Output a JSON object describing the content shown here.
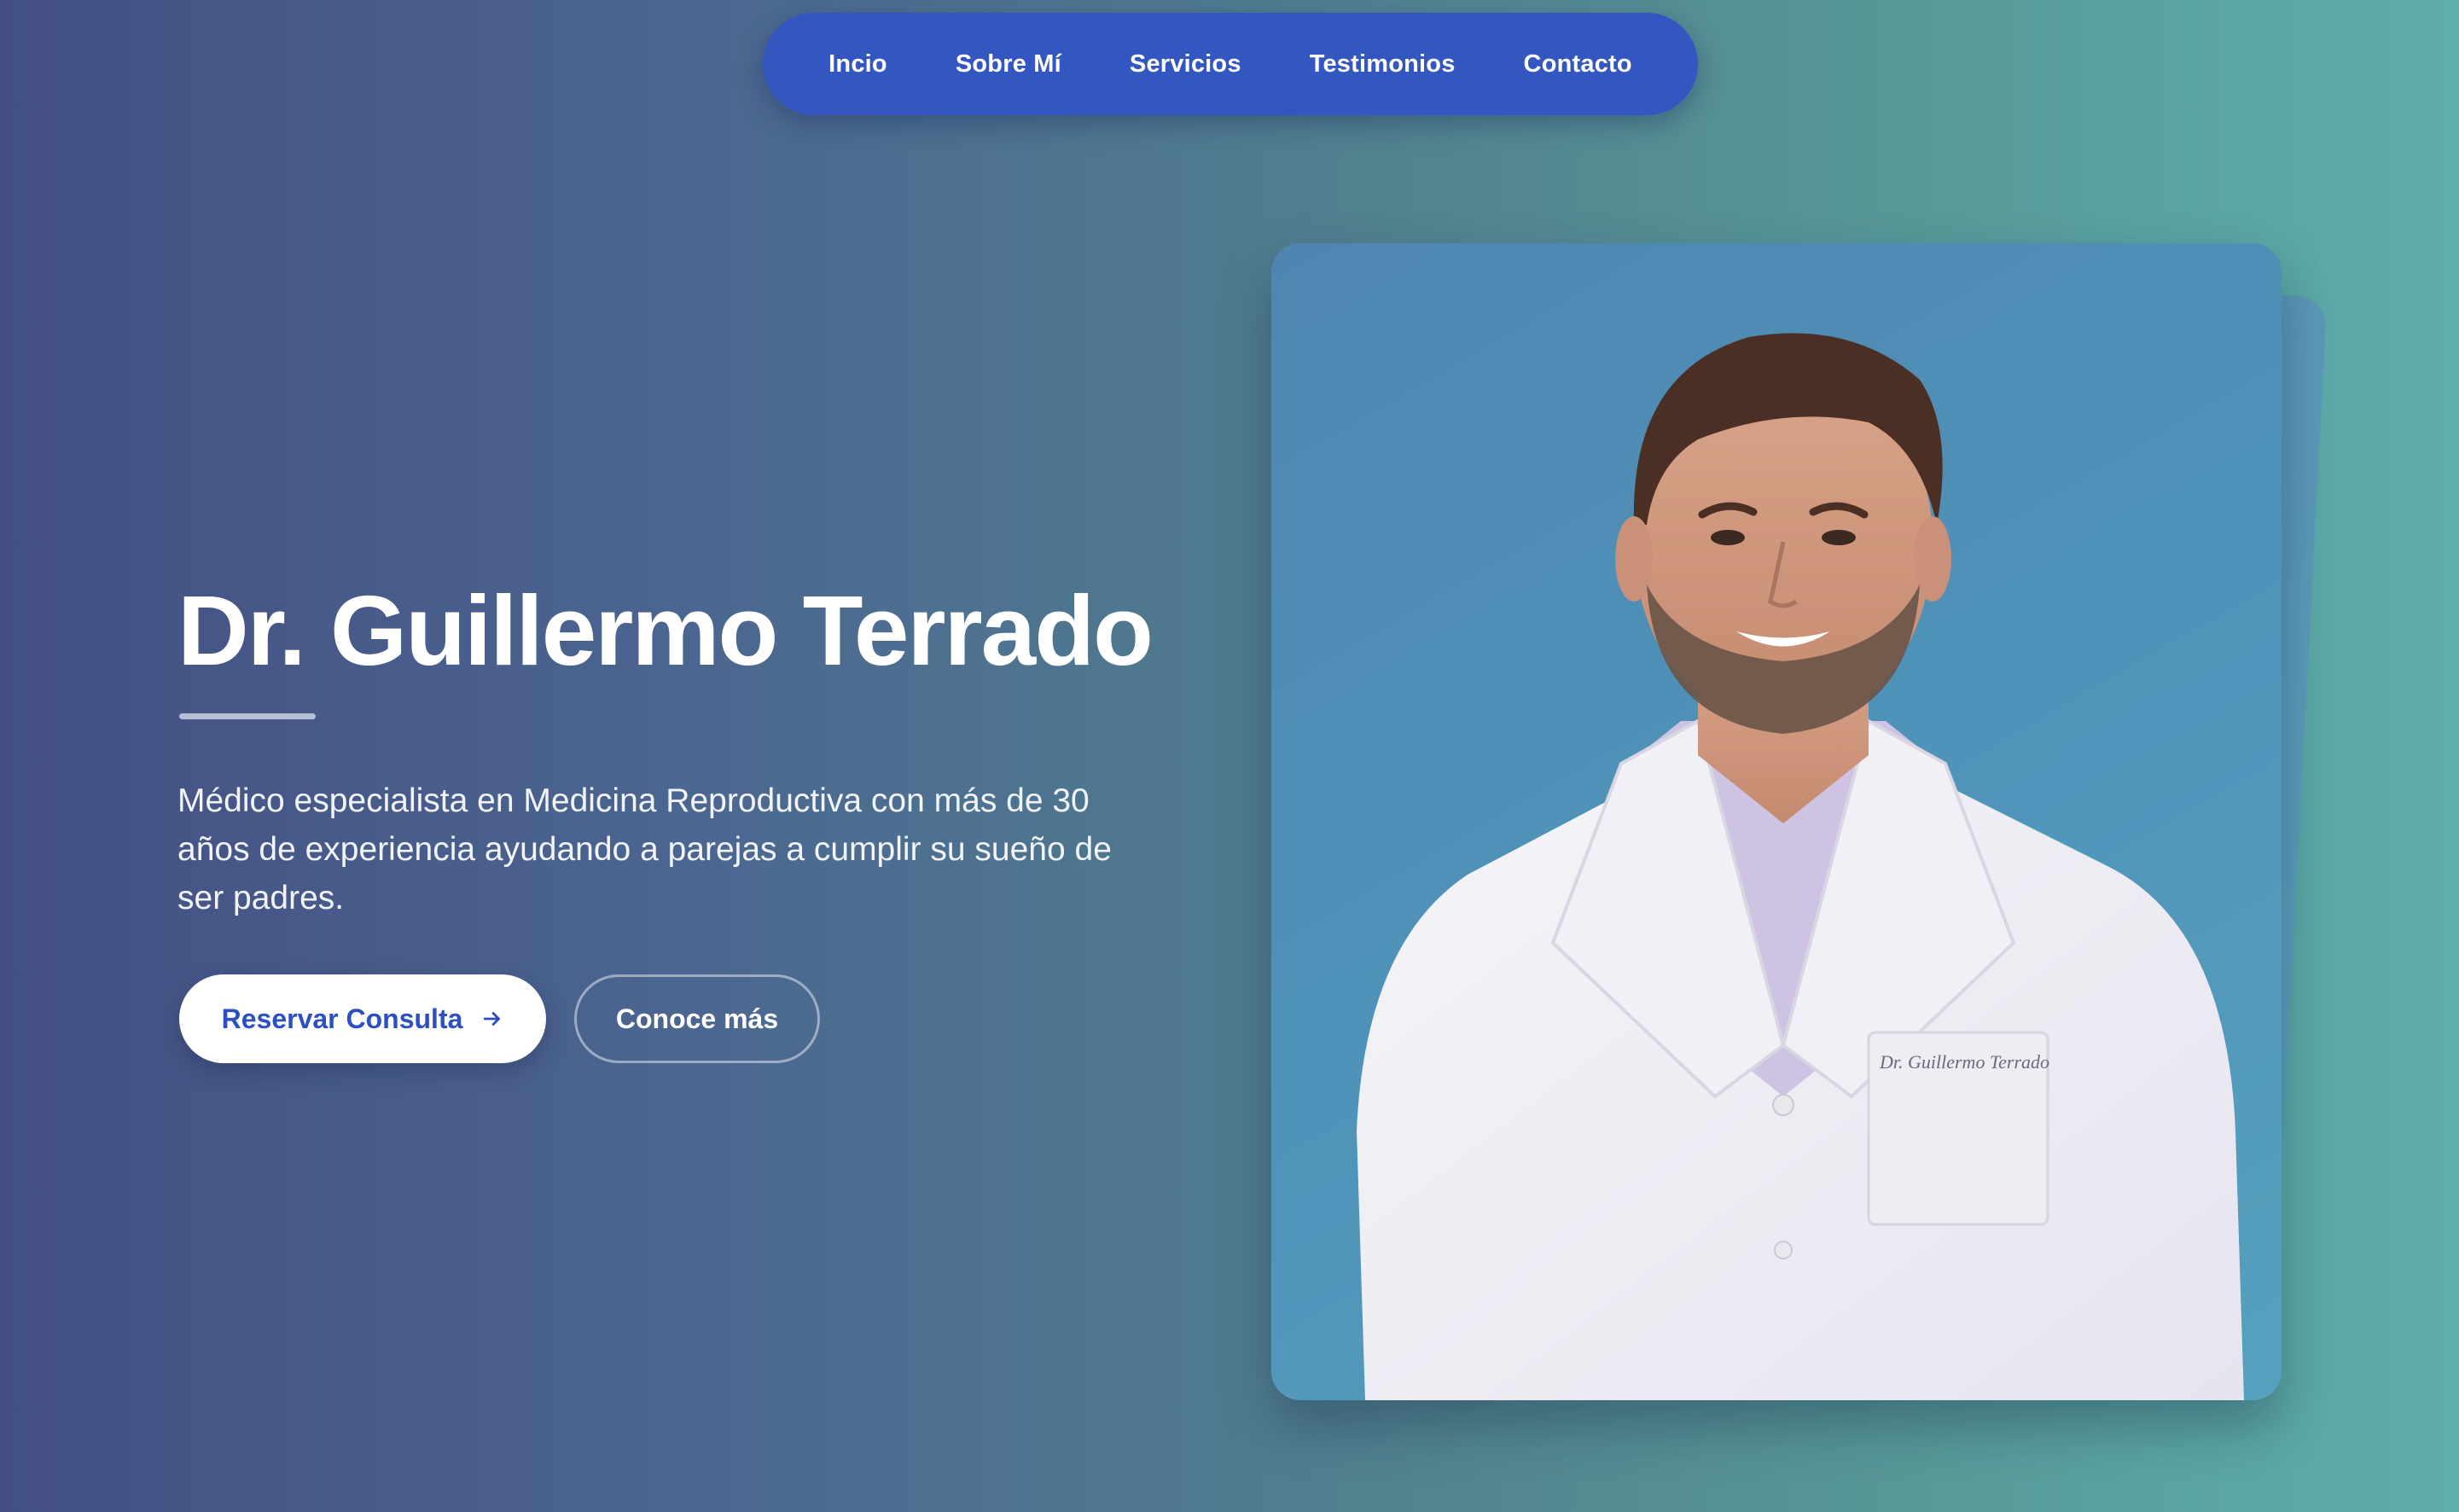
{
  "nav": {
    "items": [
      {
        "label": "Incio"
      },
      {
        "label": "Sobre Mí"
      },
      {
        "label": "Servicios"
      },
      {
        "label": "Testimonios"
      },
      {
        "label": "Contacto"
      }
    ]
  },
  "hero": {
    "title": "Dr. Guillermo Terrado",
    "description": "Médico especialista en Medicina Reproductiva con más de 30 años de experiencia ayudando a parejas a cumplir su sueño de ser padres.",
    "primary_button": {
      "label": "Reservar Consulta",
      "icon": "arrow-right-icon"
    },
    "secondary_button": {
      "label": "Conoce más"
    }
  },
  "portrait": {
    "badge_text": "Dr. Guillermo Terrado",
    "subject": "doctor-portrait"
  },
  "colors": {
    "nav_bg": "#3356c0",
    "accent_blue": "#2c4fc2",
    "gradient_start": "#434f83",
    "gradient_end": "#5eaeac"
  }
}
